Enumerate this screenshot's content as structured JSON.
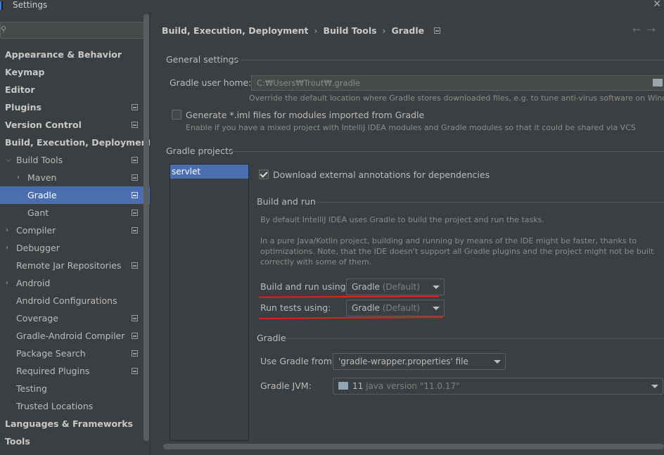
{
  "window": {
    "title": "Settings"
  },
  "search": {
    "placeholder": ""
  },
  "sidebar": {
    "items": [
      {
        "label": "Appearance & Behavior"
      },
      {
        "label": "Keymap"
      },
      {
        "label": "Editor"
      },
      {
        "label": "Plugins"
      },
      {
        "label": "Version Control"
      },
      {
        "label": "Build, Execution, Deployment"
      },
      {
        "label": "Build Tools"
      },
      {
        "label": "Maven"
      },
      {
        "label": "Gradle"
      },
      {
        "label": "Gant"
      },
      {
        "label": "Compiler"
      },
      {
        "label": "Debugger"
      },
      {
        "label": "Remote Jar Repositories"
      },
      {
        "label": "Android"
      },
      {
        "label": "Android Configurations"
      },
      {
        "label": "Coverage"
      },
      {
        "label": "Gradle-Android Compiler"
      },
      {
        "label": "Package Search"
      },
      {
        "label": "Required Plugins"
      },
      {
        "label": "Testing"
      },
      {
        "label": "Trusted Locations"
      },
      {
        "label": "Languages & Frameworks"
      },
      {
        "label": "Tools"
      }
    ]
  },
  "breadcrumb": {
    "part1": "Build, Execution, Deployment",
    "part2": "Build Tools",
    "part3": "Gradle",
    "sep": "›"
  },
  "nav": {
    "back": "←",
    "forward": "→"
  },
  "general": {
    "title": "General settings",
    "user_home_label": "Gradle user home:",
    "user_home_value": "C:₩Users₩Trout₩.gradle",
    "user_home_hint": "Override the default location where Gradle stores downloaded files, e.g. to tune anti-virus software on Windows",
    "iml_label": "Generate *.iml files for modules imported from Gradle",
    "iml_hint": "Enable if you have a mixed project with IntelliJ IDEA modules and Gradle modules so that it could be shared via VCS"
  },
  "projects": {
    "title": "Gradle projects",
    "list": [
      "servlet"
    ],
    "download_annotations_label": "Download external annotations for dependencies",
    "build_run_title": "Build and run",
    "build_run_hint1": "By default IntelliJ IDEA uses Gradle to build the project and run the tasks.",
    "build_run_hint2a": "In a pure Java/Kotlin project, building and running by means of the IDE might be faster, thanks to",
    "build_run_hint2b": "optimizations. Note, that the IDE doesn't support all Gradle plugins and the project might not be built",
    "build_run_hint2c": "correctly with some of them.",
    "build_run_using_label": "Build and run using:",
    "build_run_using_value": "Gradle",
    "build_run_using_suffix": "(Default)",
    "run_tests_label": "Run tests using:",
    "run_tests_value": "Gradle",
    "run_tests_suffix": "(Default)",
    "gradle_title": "Gradle",
    "use_gradle_from_label": "Use Gradle from:",
    "use_gradle_from_value": "'gradle-wrapper.properties' file",
    "jvm_label": "Gradle JVM:",
    "jvm_version": "11",
    "jvm_detail": "java version \"11.0.17\""
  },
  "colors": {
    "selection": "#4b6eaf",
    "annotation": "#e0231d"
  }
}
